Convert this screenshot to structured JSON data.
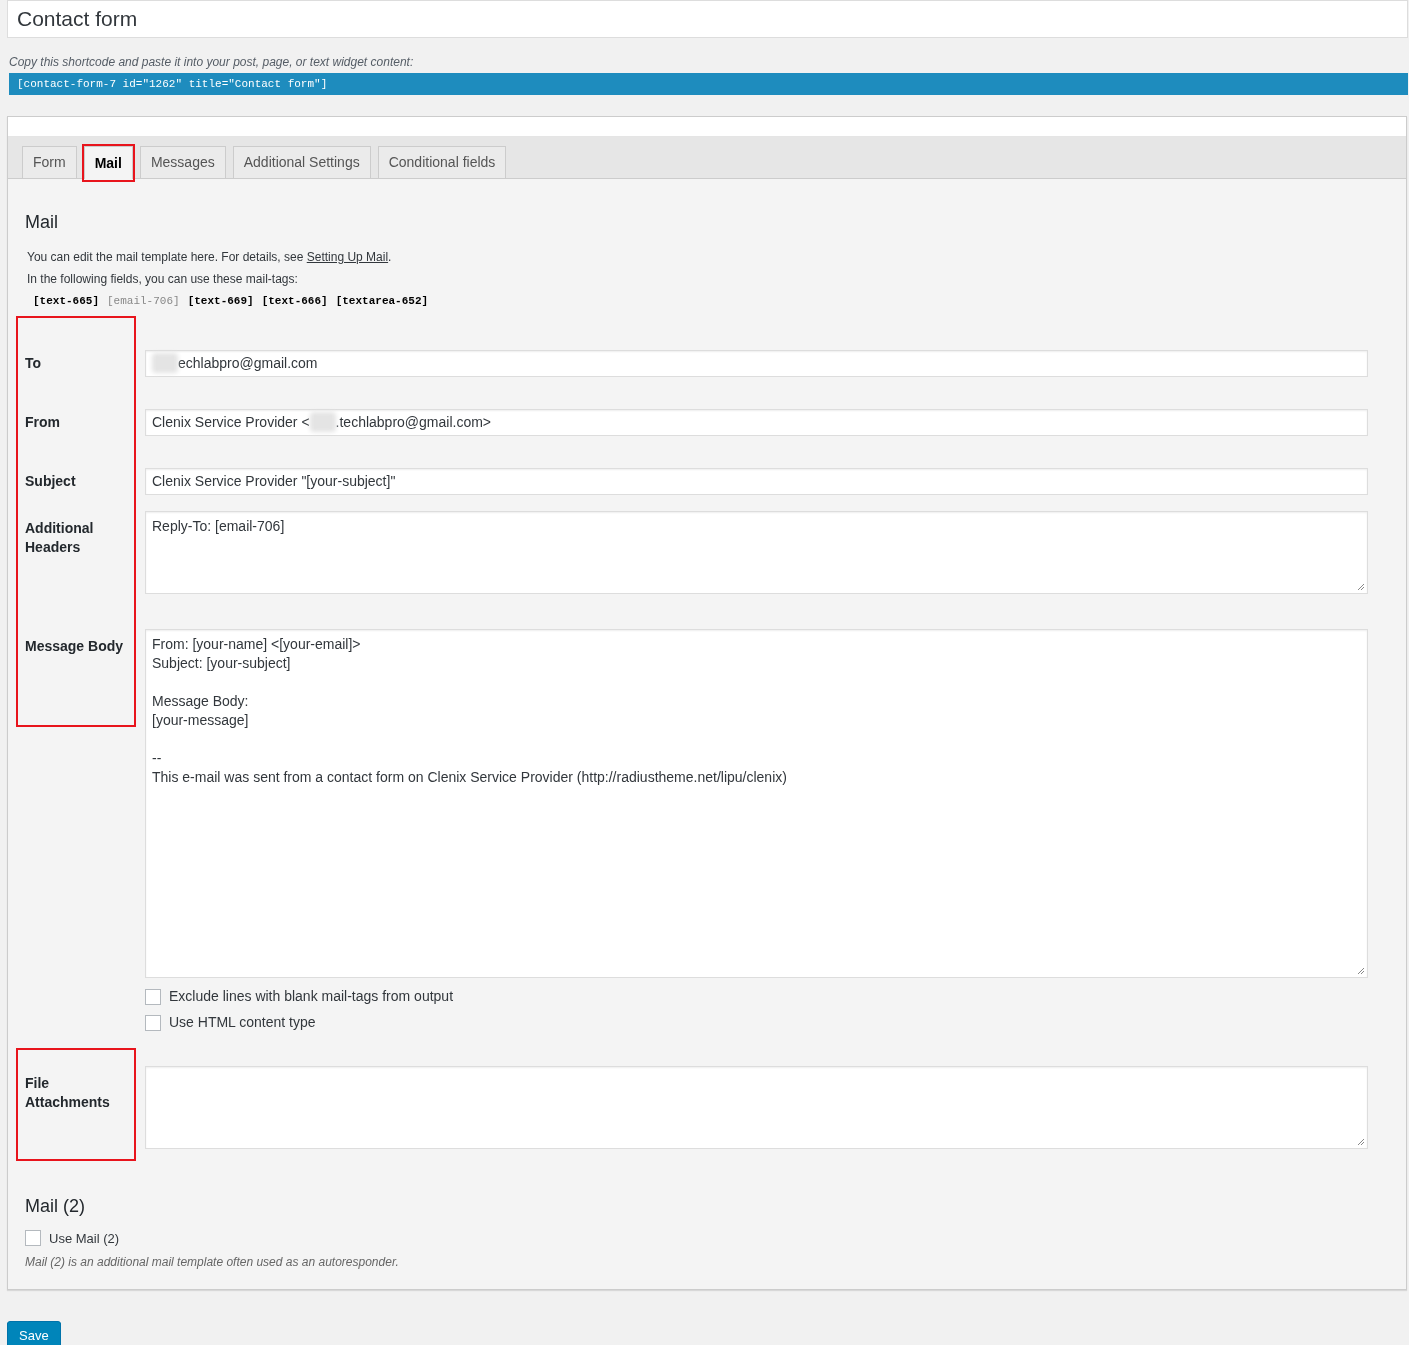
{
  "title": "Contact form",
  "shortcode": {
    "hint": "Copy this shortcode and paste it into your post, page, or text widget content:",
    "code": "[contact-form-7 id=\"1262\" title=\"Contact form\"]"
  },
  "tabs": [
    {
      "label": "Form",
      "selected": false,
      "highlighted": false
    },
    {
      "label": "Mail",
      "selected": true,
      "highlighted": true
    },
    {
      "label": "Messages",
      "selected": false,
      "highlighted": false
    },
    {
      "label": "Additional Settings",
      "selected": false,
      "highlighted": false
    },
    {
      "label": "Conditional fields",
      "selected": false,
      "highlighted": false
    }
  ],
  "mail": {
    "heading": "Mail",
    "intro": "You can edit the mail template here. For details, see",
    "link": "Setting Up Mail",
    "intro_end": ".",
    "tags_intro": "In the following fields, you can use these mail-tags:",
    "tags": [
      {
        "text": "[text-665]",
        "used": true
      },
      {
        "text": "[email-706]",
        "used": false
      },
      {
        "text": "[text-669]",
        "used": true
      },
      {
        "text": "[text-666]",
        "used": true
      },
      {
        "text": "[textarea-652]",
        "used": true
      }
    ],
    "fields": [
      {
        "label": "To",
        "kind": "input",
        "value_parts": [
          "echlabpro@gmail.com"
        ],
        "blur_start": true,
        "highlighted": true
      },
      {
        "label": "From",
        "kind": "input",
        "value_parts": [
          "Clenix Service Provider <",
          ".techlabpro@gmail.com>"
        ],
        "blur_start": false,
        "highlighted": true
      },
      {
        "label": "Subject",
        "kind": "input",
        "value_parts": [
          "Clenix Service Provider \"[your-subject]\""
        ],
        "blur_start": false,
        "highlighted": true
      },
      {
        "label": "Additional Headers",
        "kind": "textarea",
        "blocks": [
          [
            "Reply-To: [email-706]"
          ]
        ],
        "highlighted": true
      },
      {
        "label": "Message Body",
        "kind": "bodyarea",
        "blocks": [
          [
            "From: [your-name] <[your-email]>",
            "Subject: [your-subject]"
          ],
          [
            "Message Body:",
            "[your-message]"
          ],
          [
            "--",
            "This e-mail was sent from a contact form on Clenix Service Provider (http://radiustheme.net/lipu/clenix)"
          ]
        ],
        "highlighted": true
      },
      {
        "kind": "checkbox",
        "label": "Exclude lines with blank mail-tags from output",
        "checked": false
      },
      {
        "kind": "checkbox",
        "label": "Use HTML content type",
        "checked": false
      },
      {
        "label": "File Attachments",
        "kind": "textarea",
        "highlighted": true
      }
    ]
  },
  "mail2": {
    "heading": "Mail (2)",
    "checkbox": {
      "label": "Use Mail (2)",
      "checked": false
    },
    "note": "Mail (2) is an additional mail template often used as an autoresponder."
  },
  "save": "Save"
}
